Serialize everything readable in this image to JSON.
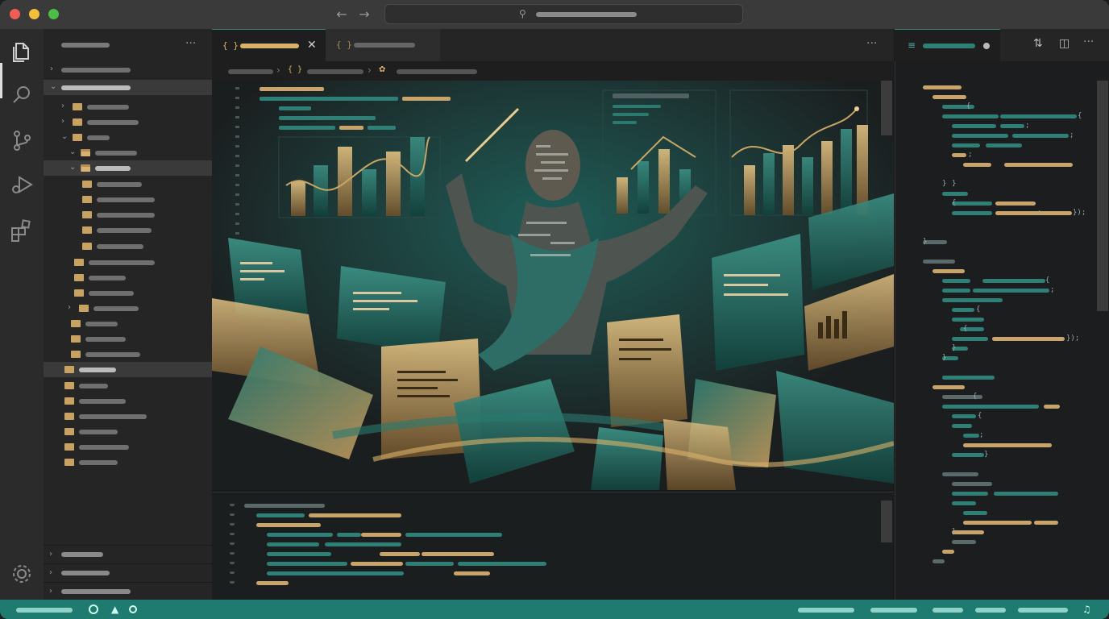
{
  "window": {
    "traffic_lights": [
      "close",
      "minimize",
      "zoom"
    ],
    "nav_back_icon": "arrow-left-icon",
    "nav_forward_icon": "arrow-right-icon"
  },
  "search": {
    "icon": "search-icon"
  },
  "activity_bar": {
    "items": [
      {
        "name": "explorer",
        "icon": "files-icon",
        "active": true
      },
      {
        "name": "search",
        "icon": "search-icon"
      },
      {
        "name": "source-control",
        "icon": "source-control-icon"
      },
      {
        "name": "run-debug",
        "icon": "run-debug-icon"
      },
      {
        "name": "extensions",
        "icon": "extensions-icon"
      }
    ],
    "bottom_icon": "gear-icon"
  },
  "sidebar": {
    "more_icon": "ellipsis-icon"
  },
  "tabs": [
    {
      "icon": "{ }",
      "active": true,
      "close_icon": "close-icon"
    },
    {
      "icon": "{ }",
      "active": false
    }
  ],
  "breadcrumb": {
    "brace": "{ }"
  },
  "right_editor": {
    "toolbar_icons": [
      "compare-icon",
      "split-editor-icon",
      "ellipsis-icon"
    ],
    "code_tokens": [
      "{",
      "{",
      ";",
      ";",
      ";",
      "}",
      "}",
      "{",
      ";",
      "});",
      "}",
      "{",
      ";",
      "{",
      "{",
      "});",
      "}",
      "}",
      "{",
      "{",
      ";",
      "}",
      "}"
    ]
  },
  "status_bar": {
    "icons": [
      "remote-icon",
      "warning-icon",
      "error-icon",
      "bell-icon"
    ]
  },
  "colors": {
    "accent_teal": "#1f7a70",
    "accent_gold": "#c8a263",
    "code_teal": "#2e8076",
    "code_gold": "#c9a46a"
  }
}
